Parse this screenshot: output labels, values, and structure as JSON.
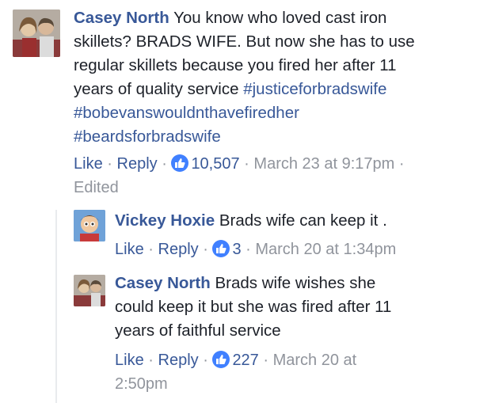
{
  "comments": [
    {
      "author": "Casey North",
      "text_parts": [
        "You know who loved cast iron",
        "skillets? BRADS WIFE. But now she has to use",
        "regular skillets because you fired her after 11",
        "years of quality service"
      ],
      "hashtags": [
        "#justiceforbradswife",
        "#bobevanswouldnthavefiredher",
        "#beardsforbradswife"
      ],
      "actions": {
        "like": "Like",
        "reply": "Reply"
      },
      "reaction_count": "10,507",
      "timestamp": "March 23 at 9:17pm",
      "edited": "Edited"
    }
  ],
  "replies": [
    {
      "author": "Vickey Hoxie",
      "text": "Brads wife can keep it .",
      "actions": {
        "like": "Like",
        "reply": "Reply"
      },
      "reaction_count": "3",
      "timestamp": "March 20 at 1:34pm"
    },
    {
      "author": "Casey North",
      "text_lines": [
        "Brads wife wishes she",
        "could keep it but she was fired after 11",
        "years of faithful service"
      ],
      "actions": {
        "like": "Like",
        "reply": "Reply"
      },
      "reaction_count": "227",
      "timestamp_line1": "March 20 at",
      "timestamp_line2": "2:50pm"
    }
  ],
  "separator": "·",
  "icons": {
    "reaction": "thumbs-up-icon"
  },
  "colors": {
    "link": "#385898",
    "meta": "#90949c",
    "like_badge": "#4080ff"
  }
}
